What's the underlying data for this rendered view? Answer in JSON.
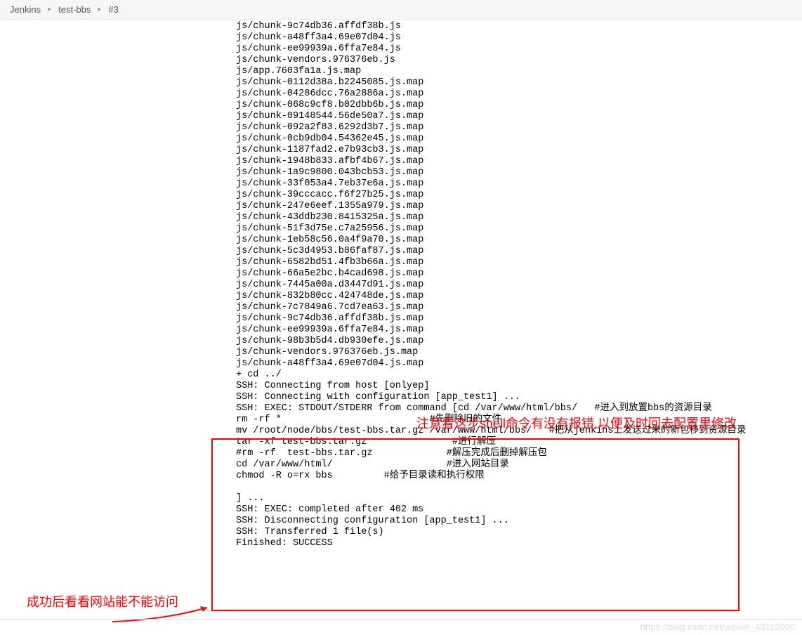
{
  "breadcrumb": {
    "items": [
      "Jenkins",
      "test-bbs",
      "#3"
    ]
  },
  "console": {
    "lines": [
      "js/chunk-9c74db36.affdf38b.js",
      "js/chunk-a48ff3a4.69e07d04.js",
      "js/chunk-ee99939a.6ffa7e84.js",
      "js/chunk-vendors.976376eb.js",
      "js/app.7603fa1a.js.map",
      "js/chunk-0112d38a.b2245085.js.map",
      "js/chunk-04286dcc.76a2886a.js.map",
      "js/chunk-068c9cf8.b02dbb6b.js.map",
      "js/chunk-09148544.56de50a7.js.map",
      "js/chunk-092a2f83.6292d3b7.js.map",
      "js/chunk-0cb9db04.54362e45.js.map",
      "js/chunk-1187fad2.e7b93cb3.js.map",
      "js/chunk-1948b833.afbf4b67.js.map",
      "js/chunk-1a9c9800.043bcb53.js.map",
      "js/chunk-33f053a4.7eb37e6a.js.map",
      "js/chunk-39cccacc.f6f27b25.js.map",
      "js/chunk-247e6eef.1355a979.js.map",
      "js/chunk-43ddb230.8415325a.js.map",
      "js/chunk-51f3d75e.c7a25956.js.map",
      "js/chunk-1eb58c56.0a4f9a70.js.map",
      "js/chunk-5c3d4953.b86faf87.js.map",
      "js/chunk-6582bd51.4fb3b66a.js.map",
      "js/chunk-66a5e2bc.b4cad698.js.map",
      "js/chunk-7445a00a.d3447d91.js.map",
      "js/chunk-832b80cc.424748de.js.map",
      "js/chunk-7c7849a6.7cd7ea63.js.map",
      "js/chunk-9c74db36.affdf38b.js.map",
      "js/chunk-ee99939a.6ffa7e84.js.map",
      "js/chunk-98b3b5d4.db930efe.js.map",
      "js/chunk-vendors.976376eb.js.map",
      "js/chunk-a48ff3a4.69e07d04.js.map",
      "+ cd ../",
      "SSH: Connecting from host [onlyep]",
      "SSH: Connecting with configuration [app_test1] ...",
      "SSH: EXEC: STDOUT/STDERR from command [cd /var/www/html/bbs/   #进入到放置bbs的资源目录",
      "rm -rf *                          #先删除旧的文件",
      "mv /root/node/bbs/test-bbs.tar.gz /var/www/html/bbs/   #把从jenkins上发送过来的新包移到资源目录",
      "tar -xf test-bbs.tar.gz               #进行解压",
      "#rm -rf  test-bbs.tar.gz             #解压完成后删掉解压包",
      "cd /var/www/html/                    #进入网站目录",
      "chmod -R o=rx bbs         #给予目录读和执行权限",
      "",
      "] ...",
      "SSH: EXEC: completed after 402 ms",
      "SSH: Disconnecting configuration [app_test1] ...",
      "SSH: Transferred 1 file(s)",
      "Finished: SUCCESS"
    ]
  },
  "annotations": {
    "note1": "注意看这步shell命令有没有报错,以便及时回去配置里修改",
    "note2": "成功后看看网站能不能访问"
  },
  "watermark": "https://blog.csdn.net/weixin_43112000"
}
